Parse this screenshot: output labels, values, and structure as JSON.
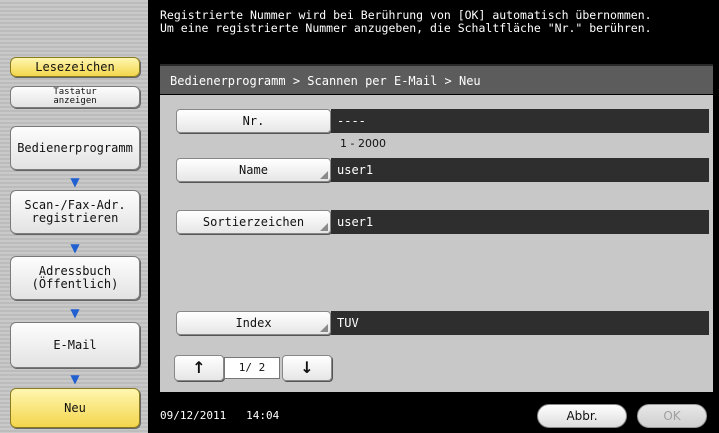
{
  "message": {
    "line1": "Registrierte Nummer wird bei Berührung von [OK] automatisch übernommen.",
    "line2": "Um eine registrierte Nummer anzugeben, die Schaltfläche \"Nr.\" berühren."
  },
  "left_panel": {
    "bookmark": "Lesezeichen",
    "keyboard": "Tastatur\nanzeigen",
    "steps": [
      "Bedienerprogramm",
      "Scan-/Fax-Adr.\nregistrieren",
      "Adressbuch\n(Öffentlich)",
      "E-Mail",
      "Neu"
    ]
  },
  "breadcrumb": "Bedienerprogramm > Scannen per E-Mail > Neu",
  "form": {
    "nr_label": "Nr.",
    "nr_value": "----",
    "nr_range": "1 - 2000",
    "name_label": "Name",
    "name_value": "user1",
    "sort_label": "Sortierzeichen",
    "sort_value": "user1",
    "index_label": "Index",
    "index_value": "TUV"
  },
  "pager": {
    "up": "↑",
    "page": "1/ 2",
    "down": "↓"
  },
  "footer": {
    "date": "09/12/2011",
    "time": "14:04",
    "cancel": "Abbr.",
    "ok": "OK"
  },
  "colors": {
    "highlight": "#f3d64c",
    "arrow": "#2060d0"
  }
}
